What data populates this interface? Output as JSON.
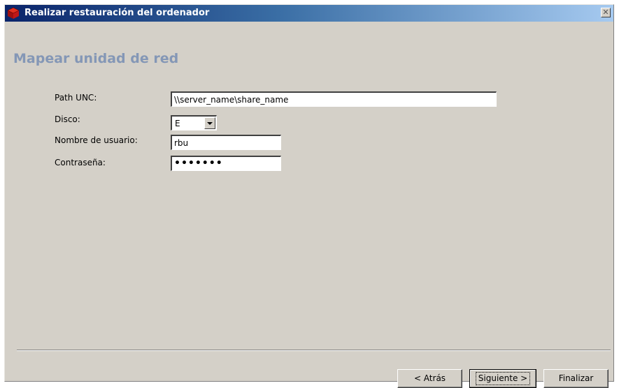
{
  "window": {
    "title": "Realizar restauración del ordenador",
    "close_glyph": "✕",
    "icon": "app-cube-icon"
  },
  "page": {
    "title": "Mapear unidad de red"
  },
  "form": {
    "path_label": "Path UNC:",
    "path_value": "\\\\server_name\\share_name",
    "disk_label": "Disco:",
    "disk_value": "E",
    "user_label": "Nombre de usuario:",
    "user_value": "rbu",
    "password_label": "Contraseña:",
    "password_value": "•••••••"
  },
  "buttons": {
    "back": "< Atrás",
    "next": "Siguiente >",
    "finish": "Finalizar"
  },
  "colors": {
    "title_gradient_start": "#0a246a",
    "title_gradient_end": "#a6caf0",
    "page_title": "#8497b6",
    "dialog_bg": "#d4d0c8"
  }
}
